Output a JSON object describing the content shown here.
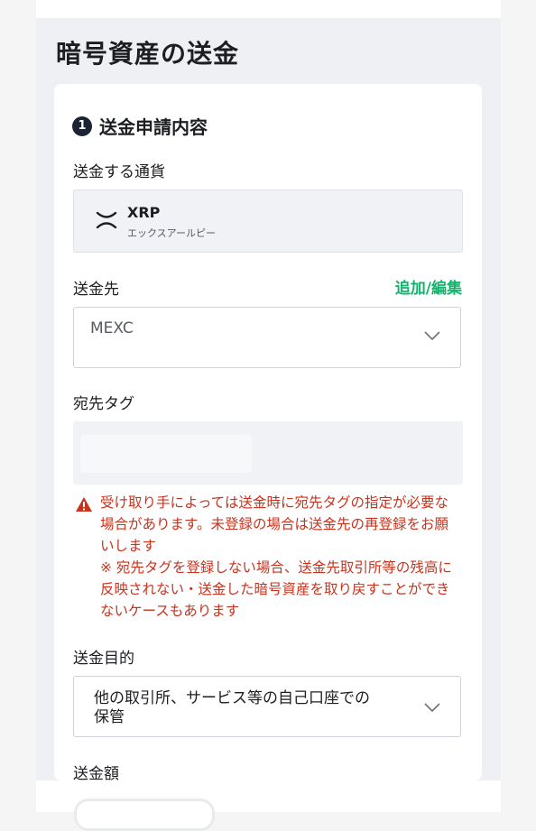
{
  "page": {
    "title": "暗号資産の送金"
  },
  "section": {
    "number": "1",
    "title": "送金申請内容"
  },
  "currency": {
    "label": "送金する通貨",
    "name": "XRP",
    "reading": "エックスアールピー",
    "icon": "xrp-icon"
  },
  "destination": {
    "label": "送金先",
    "edit_link": "追加/編集",
    "value": "MEXC"
  },
  "dest_tag": {
    "label": "宛先タグ",
    "value": ""
  },
  "warning": {
    "icon": "warning-triangle-icon",
    "line1": "受け取り手によっては送金時に宛先タグの指定が必要な場合があります。未登録の場合は送金先の再登録をお願いします",
    "line2": "※ 宛先タグを登録しない場合、送金先取引所等の残高に反映されない・送金した暗号資産を取り戻すことができないケースもあります",
    "color": "#c9331e"
  },
  "purpose": {
    "label": "送金目的",
    "value": "他の取引所、サービス等の自己口座での保管"
  },
  "amount": {
    "label": "送金額"
  },
  "colors": {
    "accent": "#12b36c",
    "dark": "#1c2433"
  }
}
